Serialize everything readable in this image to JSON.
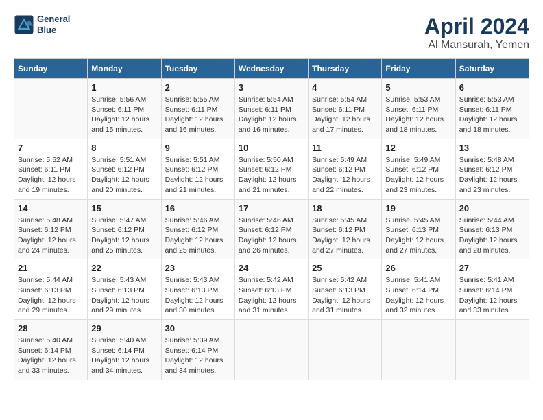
{
  "header": {
    "logo_line1": "General",
    "logo_line2": "Blue",
    "title": "April 2024",
    "subtitle": "Al Mansurah, Yemen"
  },
  "columns": [
    "Sunday",
    "Monday",
    "Tuesday",
    "Wednesday",
    "Thursday",
    "Friday",
    "Saturday"
  ],
  "weeks": [
    [
      {
        "day": "",
        "info": ""
      },
      {
        "day": "1",
        "info": "Sunrise: 5:56 AM\nSunset: 6:11 PM\nDaylight: 12 hours\nand 15 minutes."
      },
      {
        "day": "2",
        "info": "Sunrise: 5:55 AM\nSunset: 6:11 PM\nDaylight: 12 hours\nand 16 minutes."
      },
      {
        "day": "3",
        "info": "Sunrise: 5:54 AM\nSunset: 6:11 PM\nDaylight: 12 hours\nand 16 minutes."
      },
      {
        "day": "4",
        "info": "Sunrise: 5:54 AM\nSunset: 6:11 PM\nDaylight: 12 hours\nand 17 minutes."
      },
      {
        "day": "5",
        "info": "Sunrise: 5:53 AM\nSunset: 6:11 PM\nDaylight: 12 hours\nand 18 minutes."
      },
      {
        "day": "6",
        "info": "Sunrise: 5:53 AM\nSunset: 6:11 PM\nDaylight: 12 hours\nand 18 minutes."
      }
    ],
    [
      {
        "day": "7",
        "info": "Sunrise: 5:52 AM\nSunset: 6:11 PM\nDaylight: 12 hours\nand 19 minutes."
      },
      {
        "day": "8",
        "info": "Sunrise: 5:51 AM\nSunset: 6:12 PM\nDaylight: 12 hours\nand 20 minutes."
      },
      {
        "day": "9",
        "info": "Sunrise: 5:51 AM\nSunset: 6:12 PM\nDaylight: 12 hours\nand 21 minutes."
      },
      {
        "day": "10",
        "info": "Sunrise: 5:50 AM\nSunset: 6:12 PM\nDaylight: 12 hours\nand 21 minutes."
      },
      {
        "day": "11",
        "info": "Sunrise: 5:49 AM\nSunset: 6:12 PM\nDaylight: 12 hours\nand 22 minutes."
      },
      {
        "day": "12",
        "info": "Sunrise: 5:49 AM\nSunset: 6:12 PM\nDaylight: 12 hours\nand 23 minutes."
      },
      {
        "day": "13",
        "info": "Sunrise: 5:48 AM\nSunset: 6:12 PM\nDaylight: 12 hours\nand 23 minutes."
      }
    ],
    [
      {
        "day": "14",
        "info": "Sunrise: 5:48 AM\nSunset: 6:12 PM\nDaylight: 12 hours\nand 24 minutes."
      },
      {
        "day": "15",
        "info": "Sunrise: 5:47 AM\nSunset: 6:12 PM\nDaylight: 12 hours\nand 25 minutes."
      },
      {
        "day": "16",
        "info": "Sunrise: 5:46 AM\nSunset: 6:12 PM\nDaylight: 12 hours\nand 25 minutes."
      },
      {
        "day": "17",
        "info": "Sunrise: 5:46 AM\nSunset: 6:12 PM\nDaylight: 12 hours\nand 26 minutes."
      },
      {
        "day": "18",
        "info": "Sunrise: 5:45 AM\nSunset: 6:12 PM\nDaylight: 12 hours\nand 27 minutes."
      },
      {
        "day": "19",
        "info": "Sunrise: 5:45 AM\nSunset: 6:13 PM\nDaylight: 12 hours\nand 27 minutes."
      },
      {
        "day": "20",
        "info": "Sunrise: 5:44 AM\nSunset: 6:13 PM\nDaylight: 12 hours\nand 28 minutes."
      }
    ],
    [
      {
        "day": "21",
        "info": "Sunrise: 5:44 AM\nSunset: 6:13 PM\nDaylight: 12 hours\nand 29 minutes."
      },
      {
        "day": "22",
        "info": "Sunrise: 5:43 AM\nSunset: 6:13 PM\nDaylight: 12 hours\nand 29 minutes."
      },
      {
        "day": "23",
        "info": "Sunrise: 5:43 AM\nSunset: 6:13 PM\nDaylight: 12 hours\nand 30 minutes."
      },
      {
        "day": "24",
        "info": "Sunrise: 5:42 AM\nSunset: 6:13 PM\nDaylight: 12 hours\nand 31 minutes."
      },
      {
        "day": "25",
        "info": "Sunrise: 5:42 AM\nSunset: 6:13 PM\nDaylight: 12 hours\nand 31 minutes."
      },
      {
        "day": "26",
        "info": "Sunrise: 5:41 AM\nSunset: 6:14 PM\nDaylight: 12 hours\nand 32 minutes."
      },
      {
        "day": "27",
        "info": "Sunrise: 5:41 AM\nSunset: 6:14 PM\nDaylight: 12 hours\nand 33 minutes."
      }
    ],
    [
      {
        "day": "28",
        "info": "Sunrise: 5:40 AM\nSunset: 6:14 PM\nDaylight: 12 hours\nand 33 minutes."
      },
      {
        "day": "29",
        "info": "Sunrise: 5:40 AM\nSunset: 6:14 PM\nDaylight: 12 hours\nand 34 minutes."
      },
      {
        "day": "30",
        "info": "Sunrise: 5:39 AM\nSunset: 6:14 PM\nDaylight: 12 hours\nand 34 minutes."
      },
      {
        "day": "",
        "info": ""
      },
      {
        "day": "",
        "info": ""
      },
      {
        "day": "",
        "info": ""
      },
      {
        "day": "",
        "info": ""
      }
    ]
  ]
}
